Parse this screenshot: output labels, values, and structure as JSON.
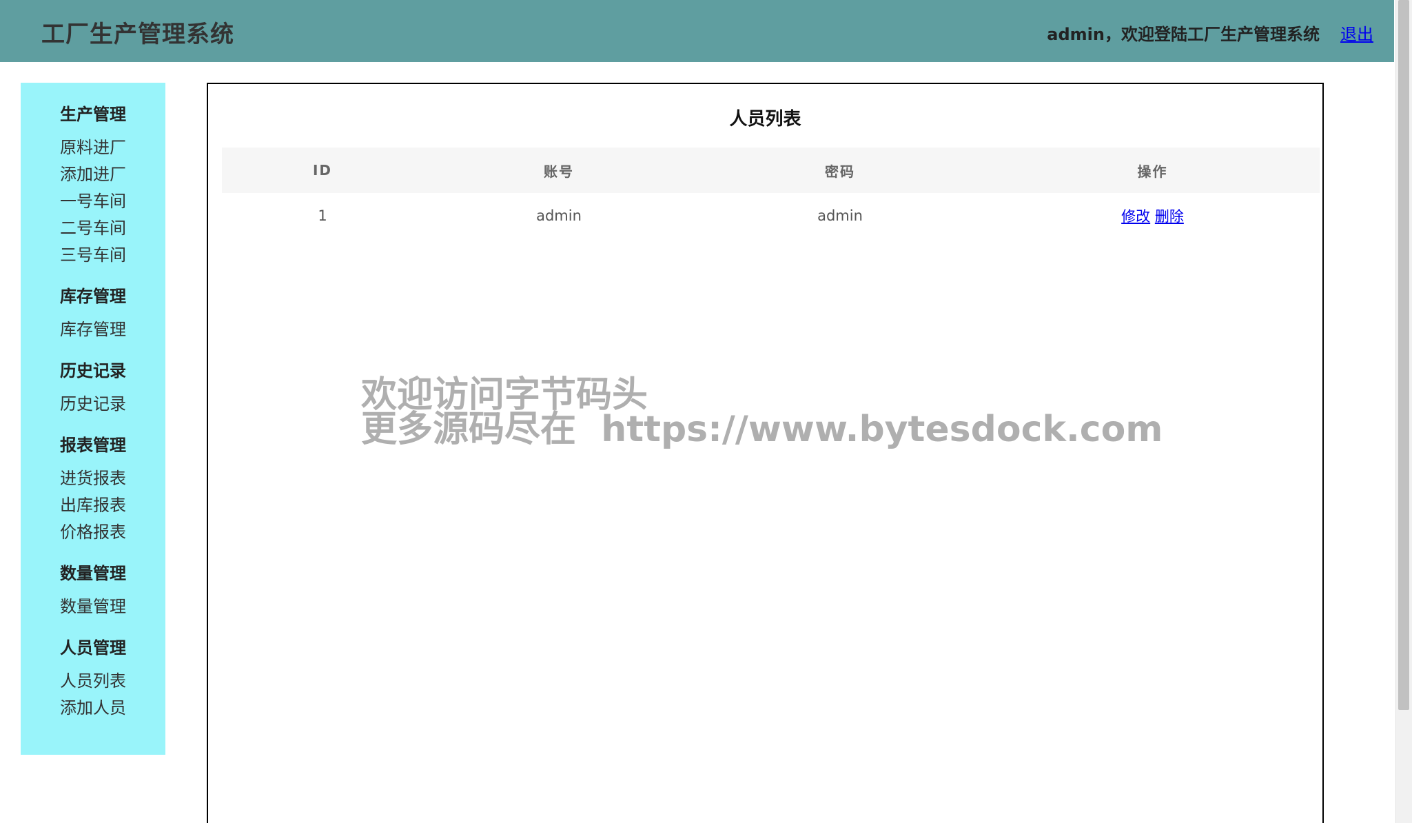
{
  "header": {
    "title": "工厂生产管理系统",
    "welcome": "admin，欢迎登陆工厂生产管理系统",
    "logout": "退出"
  },
  "sidebar": {
    "groups": [
      {
        "heading": "生产管理",
        "items": [
          "原料进厂",
          "添加进厂",
          "一号车间",
          "二号车间",
          "三号车间"
        ]
      },
      {
        "heading": "库存管理",
        "items": [
          "库存管理"
        ]
      },
      {
        "heading": "历史记录",
        "items": [
          "历史记录"
        ]
      },
      {
        "heading": "报表管理",
        "items": [
          "进货报表",
          "出库报表",
          "价格报表"
        ]
      },
      {
        "heading": "数量管理",
        "items": [
          "数量管理"
        ]
      },
      {
        "heading": "人员管理",
        "items": [
          "人员列表",
          "添加人员"
        ]
      }
    ]
  },
  "main": {
    "title": "人员列表",
    "columns": [
      "ID",
      "账号",
      "密码",
      "操作"
    ],
    "rows": [
      {
        "id": "1",
        "account": "admin",
        "password": "admin",
        "edit": "修改",
        "delete": "删除"
      }
    ]
  },
  "watermark": {
    "line1": "欢迎访问字节码头",
    "line2": "更多源码尽在  https://www.bytesdock.com"
  },
  "colors": {
    "header_bg": "#5f9ea0",
    "sidebar_bg": "#99f4fa",
    "link": "#0000ee"
  }
}
